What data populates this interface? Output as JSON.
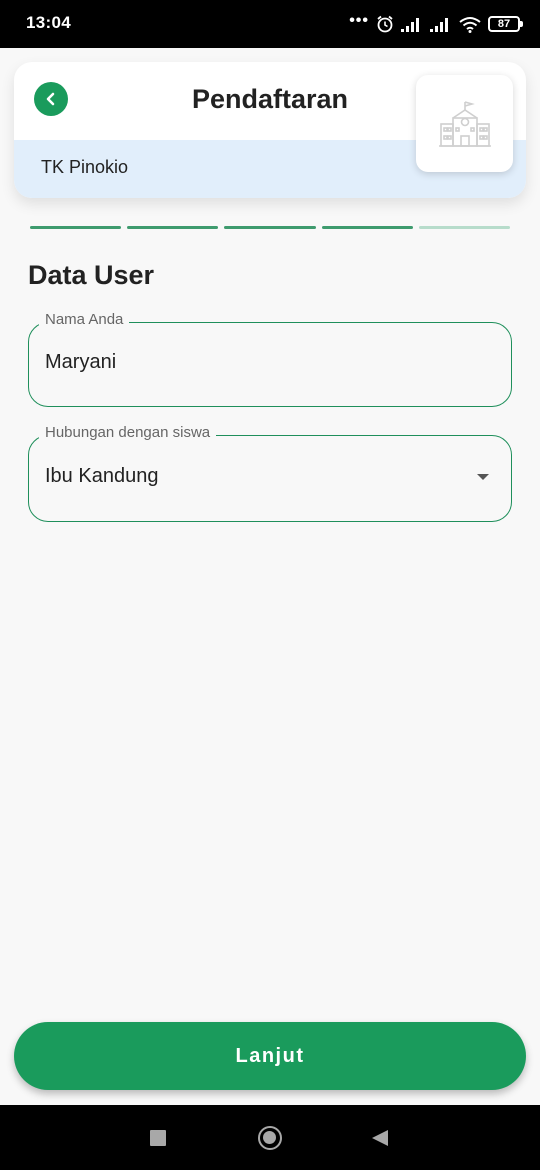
{
  "status_bar": {
    "time": "13:04",
    "battery": "87",
    "icons": [
      "dots-icon",
      "alarm-icon",
      "signal-icon",
      "signal-icon",
      "wifi-icon",
      "battery-icon"
    ]
  },
  "header": {
    "title": "Pendaftaran",
    "school_name": "TK Pinokio",
    "back_icon": "chevron-left-icon",
    "logo_icon": "school-building-icon"
  },
  "progress": {
    "total_steps": 5,
    "completed_steps": 4
  },
  "section": {
    "title": "Data User"
  },
  "form": {
    "name_field": {
      "label": "Nama Anda",
      "value": "Maryani"
    },
    "relation_field": {
      "label": "Hubungan dengan siswa",
      "selected": "Ibu Kandung"
    }
  },
  "actions": {
    "next_label": "Lanjut"
  },
  "colors": {
    "primary": "#1a9b5c",
    "sub_header_bg": "#e1eefb",
    "step_active": "#3e9b6e",
    "step_inactive": "#b7dccb"
  }
}
